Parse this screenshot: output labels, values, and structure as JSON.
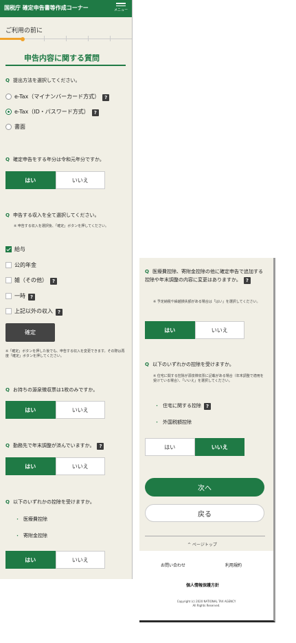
{
  "header": {
    "title": "国税庁 確定申告書等作成コーナー",
    "menu_label": "メニュー"
  },
  "breadcrumb": "ご利用の前に",
  "progress": {
    "fraction": 0.17
  },
  "section_title": "申告内容に関する質問",
  "q_mark": "Q",
  "help_glyph": "?",
  "q1": {
    "text": "提出方法を選択してください。",
    "options": [
      "e-Tax（マイナンバーカード方式）",
      "e-Tax（ID・パスワード方式）",
      "書面"
    ]
  },
  "q2": {
    "text": "確定申告をする年分は令和元年分ですか。"
  },
  "q3": {
    "text": "申告する収入を全て選択してください。",
    "note": "※ 申告する収入を選択後、「確定」ボタンを押してください。",
    "options": [
      "給与",
      "公的年金",
      "雑（その他）",
      "一時",
      "上記以外の収入"
    ],
    "confirm_label": "確定",
    "after_note": "※「確定」ボタンを押した後でも、申告する収入を変更できます。その際は再度「確定」ボタンを押してください。"
  },
  "q4": {
    "text": "お持ちの源泉徴収票は1枚のみですか。"
  },
  "q5": {
    "text": "勤務先で年末調整が済んでいますか。"
  },
  "q6": {
    "text": "以下のいずれかの控除を受けますか。",
    "items": [
      "医療費控除",
      "寄附金控除"
    ]
  },
  "q7": {
    "text": "医療費控除、寄附金控除の他に確定申告で追加する控除や年末調整の内容に変更はありますか。",
    "note": "※ 予定納税や繰越損失額がある場合は「はい」を選択してください。"
  },
  "q8": {
    "text": "以下のいずれかの控除を受けますか。",
    "note": "※ 住宅に関する控除が源泉徴収票に記載がある場合（年末調整で適用を受けている場合）、「いいえ」を選択してください。",
    "items": [
      "住宅に関する控除",
      "外国税額控除"
    ]
  },
  "yes_label": "はい",
  "no_label": "いいえ",
  "next_label": "次へ",
  "back_label": "戻る",
  "pagetop_label": "^ ページトップ",
  "footer": {
    "contact": "お問い合わせ",
    "terms": "利用規約",
    "privacy": "個人情報保護方針",
    "copyright1": "Copyright (c) 2020 NATIONAL TAX AGENCY",
    "copyright2": "All Rights Reserved."
  },
  "colors": {
    "green": "#1f7a45",
    "orange": "#f0a22a",
    "bg": "#f1efe5"
  }
}
